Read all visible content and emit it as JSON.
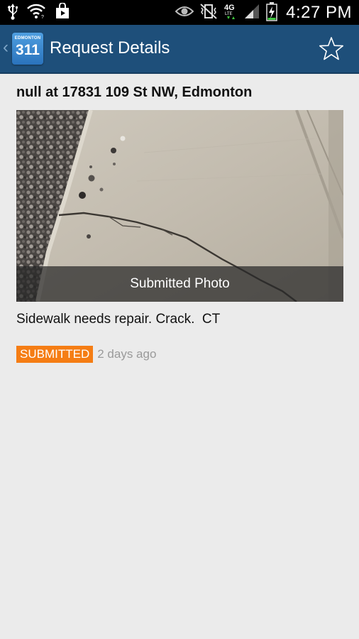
{
  "status_bar": {
    "time": "4:27 PM",
    "left_icons": [
      "usb-icon",
      "wifi-icon",
      "play-store-icon"
    ],
    "right_icons": [
      "eye-icon",
      "vibrate-icon",
      "lte-4g-icon",
      "signal-icon",
      "battery-charging-icon"
    ],
    "network": "4G"
  },
  "action_bar": {
    "logo_top": "EDMONTON",
    "logo_number": "311",
    "title": "Request Details",
    "favorite_icon": "star-icon"
  },
  "request": {
    "address_title": "null at 17831 109 St NW, Edmonton",
    "photo_caption": "Submitted Photo",
    "description": "Sidewalk needs repair. Crack.  CT",
    "status": "SUBMITTED",
    "time_ago": "2 days ago"
  },
  "colors": {
    "action_bar": "#1e4f7a",
    "status_badge": "#f57d14",
    "background": "#ebebeb"
  }
}
